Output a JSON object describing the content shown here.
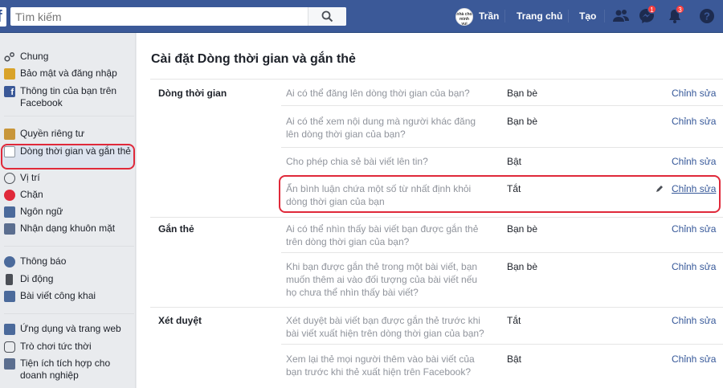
{
  "header": {
    "logo": "f",
    "search_placeholder": "Tìm kiếm",
    "avatar_text": "nhà cho mình vui",
    "user_name": "Trần",
    "home_label": "Trang chủ",
    "create_label": "Tạo",
    "messages_badge": "1",
    "notifications_badge": "3"
  },
  "sidebar": {
    "items": [
      {
        "label": "Chung",
        "icon": "gear-icon"
      },
      {
        "label": "Bảo mật và đăng nhập",
        "icon": "shield-icon"
      },
      {
        "label": "Thông tin của bạn trên Facebook",
        "icon": "facebook-icon"
      },
      {
        "label": "Quyền riêng tư",
        "icon": "lock-icon"
      },
      {
        "label": "Dòng thời gian và gắn thẻ",
        "icon": "timeline-icon"
      },
      {
        "label": "Vị trí",
        "icon": "location-icon"
      },
      {
        "label": "Chặn",
        "icon": "block-icon"
      },
      {
        "label": "Ngôn ngữ",
        "icon": "language-icon"
      },
      {
        "label": "Nhận dạng khuôn mặt",
        "icon": "face-icon"
      },
      {
        "label": "Thông báo",
        "icon": "globe-icon"
      },
      {
        "label": "Di động",
        "icon": "mobile-icon"
      },
      {
        "label": "Bài viết công khai",
        "icon": "rss-icon"
      },
      {
        "label": "Ứng dụng và trang web",
        "icon": "apps-icon"
      },
      {
        "label": "Trò chơi tức thời",
        "icon": "gamepad-icon"
      },
      {
        "label": "Tiện ích tích hợp cho doanh nghiệp",
        "icon": "business-icon"
      }
    ]
  },
  "main": {
    "title": "Cài đặt Dòng thời gian và gắn thẻ",
    "sections": [
      {
        "label": "Dòng thời gian",
        "rows": [
          {
            "question": "Ai có thể đăng lên dòng thời gian của bạn?",
            "value": "Bạn bè",
            "edit": "Chỉnh sửa"
          },
          {
            "question": "Ai có thể xem nội dung mà người khác đăng lên dòng thời gian của bạn?",
            "value": "Bạn bè",
            "edit": "Chỉnh sửa"
          },
          {
            "question": "Cho phép chia sẻ bài viết lên tin?",
            "value": "Bật",
            "edit": "Chỉnh sửa"
          },
          {
            "question": "Ẩn bình luận chứa một số từ nhất định khỏi dòng thời gian của bạn",
            "value": "Tắt",
            "edit": "Chỉnh sửa"
          }
        ]
      },
      {
        "label": "Gắn thẻ",
        "rows": [
          {
            "question": "Ai có thể nhìn thấy bài viết bạn được gắn thẻ trên dòng thời gian của bạn?",
            "value": "Bạn bè",
            "edit": "Chỉnh sửa"
          },
          {
            "question": "Khi bạn được gắn thẻ trong một bài viết, bạn muốn thêm ai vào đối tượng của bài viết nếu họ chưa thể nhìn thấy bài viết?",
            "value": "Bạn bè",
            "edit": "Chỉnh sửa"
          }
        ]
      },
      {
        "label": "Xét duyệt",
        "rows": [
          {
            "question": "Xét duyệt bài viết bạn được gắn thẻ trước khi bài viết xuất hiện trên dòng thời gian của bạn?",
            "value": "Tắt",
            "edit": "Chỉnh sửa"
          },
          {
            "question": "Xem lại thẻ mọi người thêm vào bài viết của bạn trước khi thẻ xuất hiện trên Facebook?",
            "value": "Bật",
            "edit": "Chỉnh sửa"
          }
        ]
      }
    ]
  },
  "colors": {
    "brand": "#3b5998",
    "link": "#365899",
    "highlight": "#e0293a",
    "badge": "#fa3e3e"
  }
}
